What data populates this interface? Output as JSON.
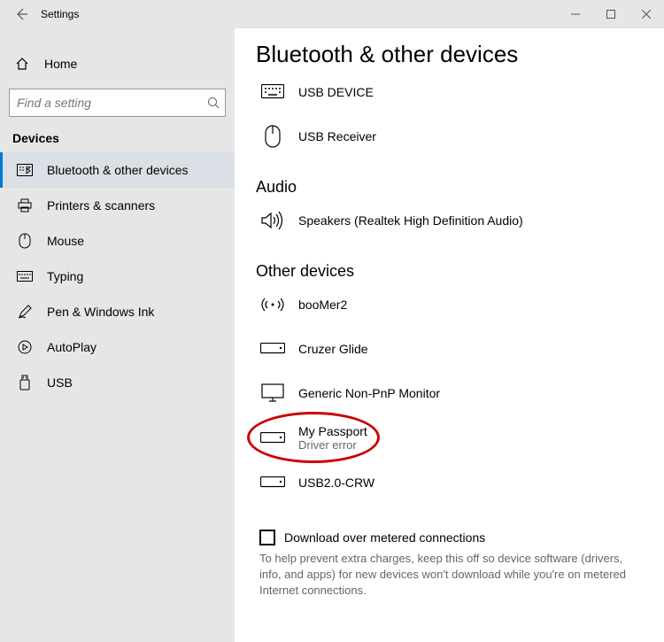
{
  "window": {
    "title": "Settings"
  },
  "sidebar": {
    "home": "Home",
    "search_placeholder": "Find a setting",
    "section": "Devices",
    "items": [
      {
        "label": "Bluetooth & other devices",
        "icon": "bluetooth-rect-icon",
        "active": true
      },
      {
        "label": "Printers & scanners",
        "icon": "printer-icon"
      },
      {
        "label": "Mouse",
        "icon": "mouse-icon"
      },
      {
        "label": "Typing",
        "icon": "keyboard-icon"
      },
      {
        "label": "Pen & Windows Ink",
        "icon": "pen-icon"
      },
      {
        "label": "AutoPlay",
        "icon": "autoplay-icon"
      },
      {
        "label": "USB",
        "icon": "usb-icon"
      }
    ]
  },
  "page": {
    "title": "Bluetooth & other devices",
    "group_top": [
      {
        "name": "USB DEVICE",
        "icon": "keyboard"
      },
      {
        "name": "USB Receiver",
        "icon": "mouse"
      }
    ],
    "audio_header": "Audio",
    "audio": [
      {
        "name": "Speakers (Realtek High Definition Audio)",
        "icon": "speaker"
      }
    ],
    "other_header": "Other devices",
    "other": [
      {
        "name": "booMer2",
        "icon": "wireless",
        "sub": ""
      },
      {
        "name": "Cruzer Glide",
        "icon": "drive",
        "sub": ""
      },
      {
        "name": "Generic Non-PnP Monitor",
        "icon": "monitor",
        "sub": ""
      },
      {
        "name": "My Passport",
        "icon": "drive",
        "sub": "Driver error",
        "circled": true
      },
      {
        "name": "USB2.0-CRW",
        "icon": "drive",
        "sub": ""
      }
    ],
    "checkbox_label": "Download over metered connections",
    "help_text": "To help prevent extra charges, keep this off so device software (drivers, info, and apps) for new devices won't download while you're on metered Internet connections."
  }
}
